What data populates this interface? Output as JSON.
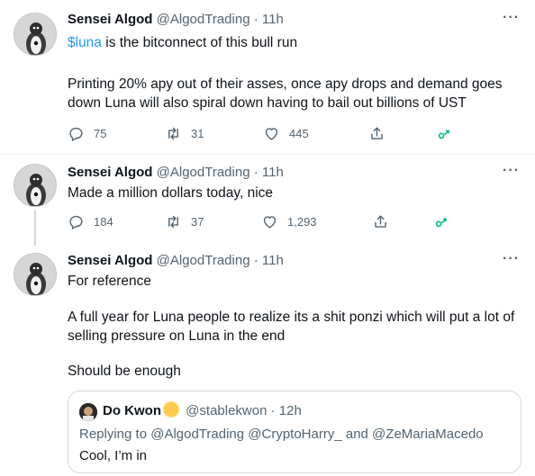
{
  "tweets": [
    {
      "name": "Sensei Algod",
      "handle": "@AlgodTrading",
      "separator": "·",
      "time": "11h",
      "cashtag": "$luna",
      "line1_rest": " is the bitconnect of this bull run",
      "para2": "Printing 20% apy out of their asses, once apy drops and demand goes down Luna will also spiral down having to bail out billions of UST",
      "replies": "75",
      "retweets": "31",
      "likes": "445"
    },
    {
      "name": "Sensei Algod",
      "handle": "@AlgodTrading",
      "separator": "·",
      "time": "11h",
      "text": "Made a million dollars today, nice",
      "replies": "184",
      "retweets": "37",
      "likes": "1,293"
    },
    {
      "name": "Sensei Algod",
      "handle": "@AlgodTrading",
      "separator": "·",
      "time": "11h",
      "para1": "For reference",
      "para2": "A full year for Luna people to realize its a shit ponzi which will put a lot of selling pressure on Luna in the end",
      "para3": "Should be enough"
    }
  ],
  "quote": {
    "name": "Do Kwon",
    "handle": "@stablekwon",
    "separator": "·",
    "time": "12h",
    "reply_line": "Replying to @AlgodTrading @CryptoHarry_ and @ZeMariaMacedo",
    "body": "Cool, I’m in"
  },
  "more_label": "···",
  "colors": {
    "accent": "#1d9bf0",
    "muted": "#536471",
    "analytics": "#00ba7c"
  },
  "icons": [
    "reply-icon",
    "retweet-icon",
    "like-icon",
    "share-icon",
    "analytics-icon",
    "more-icon",
    "verified-sun-emoji"
  ]
}
